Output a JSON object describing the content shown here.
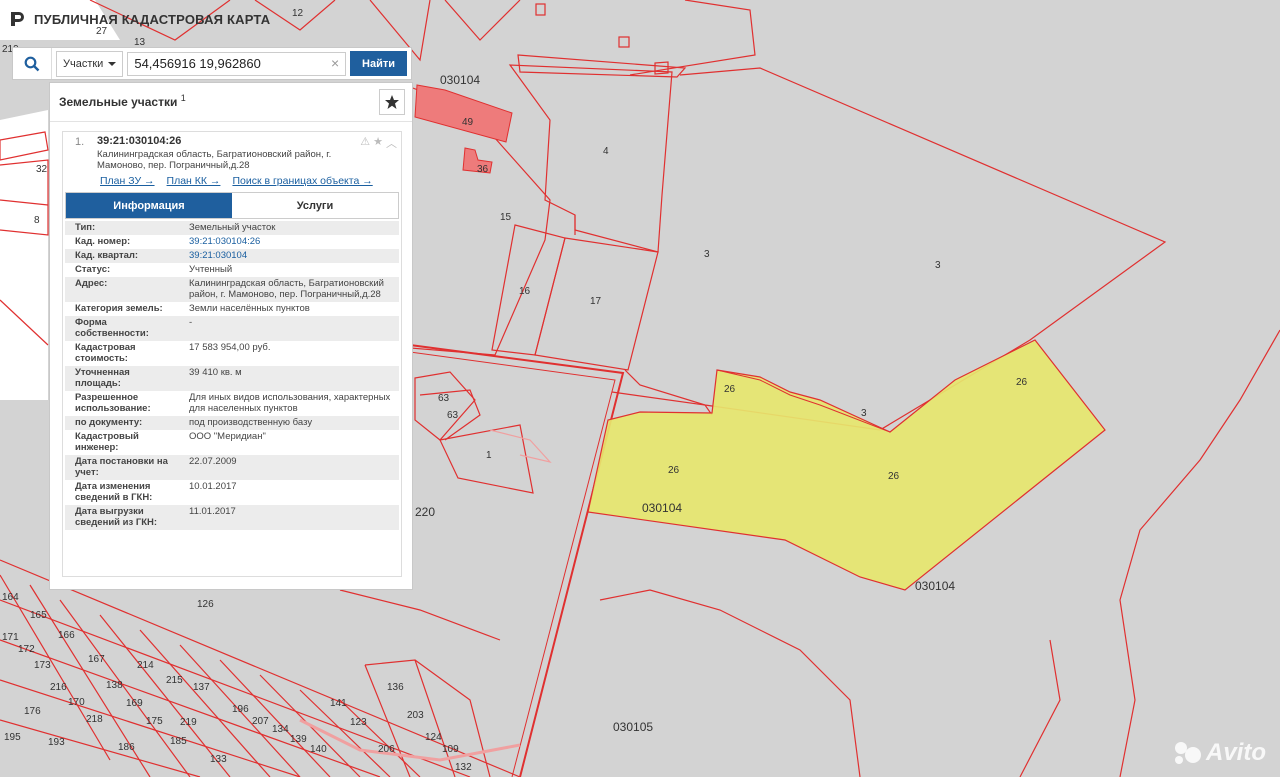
{
  "header": {
    "title": "ПУБЛИЧНАЯ КАДАСТРОВАЯ КАРТА"
  },
  "search": {
    "type_label": "Участки",
    "query": "54,456916 19,962860",
    "clear_symbol": "×",
    "button_label": "Найти"
  },
  "panel": {
    "title": "Земельные участки",
    "count": "1",
    "result": {
      "index": "1.",
      "cadastral_number": "39:21:030104:26",
      "address": "Калининградская область, Багратионовский район, г. Мамоново, пер. Пограничный,д.28",
      "links": [
        "План ЗУ →",
        "План КК →",
        "Поиск в границах объекта →"
      ],
      "tabs": [
        "Информация",
        "Услуги"
      ],
      "rows": [
        {
          "key": "Тип:",
          "value": "Земельный участок"
        },
        {
          "key": "Кад. номер:",
          "value": "39:21:030104:26",
          "link": true
        },
        {
          "key": "Кад. квартал:",
          "value": "39:21:030104",
          "link": true
        },
        {
          "key": "Статус:",
          "value": "Учтенный"
        },
        {
          "key": "Адрес:",
          "value": "Калининградская область, Багратионовский район, г. Мамоново, пер. Пограничный,д.28"
        },
        {
          "key": "Категория земель:",
          "value": "Земли населённых пунктов"
        },
        {
          "key": "Форма собственности:",
          "value": "-"
        },
        {
          "key": "Кадастровая стоимость:",
          "value": "17 583 954,00 руб."
        },
        {
          "key": "Уточненная площадь:",
          "value": "39 410 кв. м"
        },
        {
          "key": "Разрешенное использование:",
          "value": "Для иных видов использования, характерных для населенных пунктов"
        },
        {
          "key": "по документу:",
          "value": "под производственную базу"
        },
        {
          "key": "Кадастровый инженер:",
          "value": "ООО \"Меридиан\""
        },
        {
          "key": "Дата постановки на учет:",
          "value": "22.07.2009"
        },
        {
          "key": "Дата изменения сведений в ГКН:",
          "value": "10.01.2017"
        },
        {
          "key": "Дата выгрузки сведений из ГКН:",
          "value": "11.01.2017"
        }
      ]
    }
  },
  "map": {
    "colors": {
      "background": "#d3d3d3",
      "boundary": "#e03030",
      "selected_fill": "#e6e66e",
      "building_fill": "#ee7b7b"
    },
    "quarter_labels": [
      "030104",
      "030104",
      "030104",
      "030105",
      "220"
    ],
    "parcel_labels": [
      "12",
      "27",
      "13",
      "219",
      "32",
      "8",
      "49",
      "36",
      "4",
      "15",
      "16",
      "17",
      "3",
      "3",
      "3",
      "26",
      "26",
      "26",
      "26",
      "63",
      "63",
      "1",
      "126",
      "164",
      "165",
      "166",
      "167",
      "172",
      "171",
      "173",
      "214",
      "216",
      "215",
      "137",
      "138",
      "169",
      "170",
      "175",
      "185",
      "186",
      "176",
      "193",
      "195",
      "196",
      "207",
      "134",
      "139",
      "140",
      "141",
      "123",
      "206",
      "136",
      "203",
      "124",
      "109",
      "132",
      "133",
      "218",
      "219",
      "220"
    ]
  },
  "watermark": {
    "text": "Avito"
  }
}
